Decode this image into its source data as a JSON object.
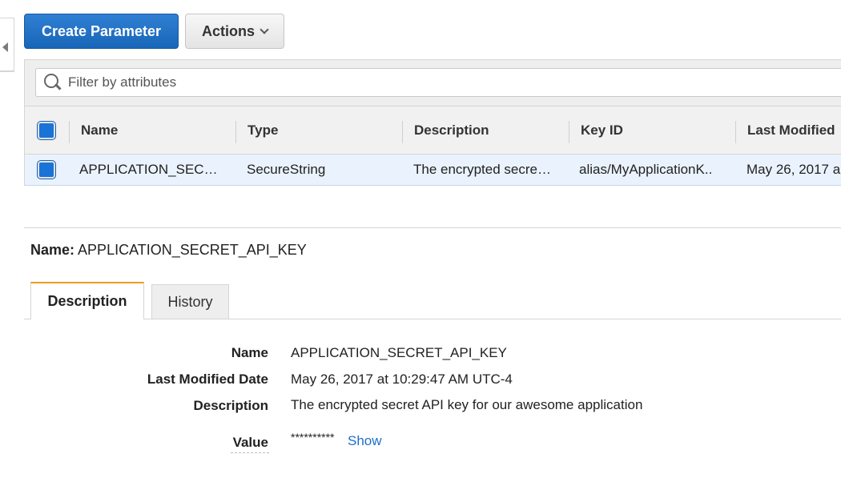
{
  "toolbar": {
    "create_label": "Create Parameter",
    "actions_label": "Actions"
  },
  "filter": {
    "placeholder": "Filter by attributes"
  },
  "table": {
    "columns": [
      "Name",
      "Type",
      "Description",
      "Key ID",
      "Last Modified"
    ],
    "rows": [
      {
        "name": "APPLICATION_SEC…",
        "type": "SecureString",
        "description": "The encrypted secre…",
        "key_id": "alias/MyApplicationK..",
        "last_modified": "May 26, 2017 a",
        "selected": true
      }
    ]
  },
  "detail": {
    "heading_label": "Name:",
    "heading_value": "APPLICATION_SECRET_API_KEY",
    "tabs": [
      "Description",
      "History"
    ],
    "active_tab": "Description",
    "fields": {
      "name_label": "Name",
      "name_value": "APPLICATION_SECRET_API_KEY",
      "modified_label": "Last Modified Date",
      "modified_value": "May 26, 2017 at 10:29:47 AM UTC-4",
      "description_label": "Description",
      "description_value": "The encrypted secret API key for our awesome application",
      "value_label": "Value",
      "value_masked": "**********",
      "show_link": "Show"
    }
  },
  "colors": {
    "primary": "#1a6fc4",
    "active_tab_accent": "#f09a1a",
    "link": "#1d6fc9",
    "selected_row": "#eaf3fd"
  }
}
